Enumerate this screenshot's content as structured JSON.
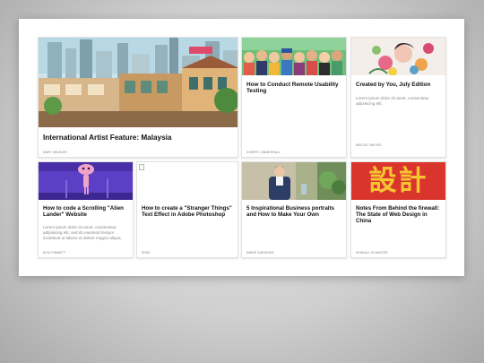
{
  "cards": [
    {
      "title": "International Artist Feature: Malaysia",
      "excerpt": "",
      "author": "Mary Winkler",
      "image": "city-illustration"
    },
    {
      "title": "How to Conduct Remote Usability Testing",
      "excerpt": "",
      "author": "Sherry Zimmerhall",
      "image": "avatars-illustration"
    },
    {
      "title": "Created by You, July Edition",
      "excerpt": "Lorem ipsum dolor sit amet, consectetur adipisicing elit.",
      "author": "Melody Nieves",
      "image": "floral-illustration"
    },
    {
      "title": "How to code a Scrolling \"Alien Lander\" Website",
      "excerpt": "Lorem ipsum dolor sit amet, consectetur adipisicing elit, sed do eiusmod tempor incididunt ut labore et dolore magna aliqua.",
      "author": "Nick Pimmett",
      "image": "alien-illustration"
    },
    {
      "title": "How to create a \"Stranger Things\" Text Effect in Adobe Photoshop",
      "excerpt": "",
      "author": "Rose",
      "image": "broken-image"
    },
    {
      "title": "5 Inspirational Business portraits and How to Make Your Own",
      "excerpt": "",
      "author": "Marie Gardiner",
      "image": "portrait-photo"
    },
    {
      "title": "Notes From Behind the firewall: The State of Web Design in China",
      "excerpt": "",
      "author": "Kendall Schaefer",
      "image": "chinese-characters"
    }
  ],
  "chinese_text": "設計",
  "colors": {
    "alien_bg": "#5b3fc4",
    "china_bg": "#d9352c",
    "china_text": "#f7c531",
    "avatars_bg": "#6fbf7a"
  }
}
